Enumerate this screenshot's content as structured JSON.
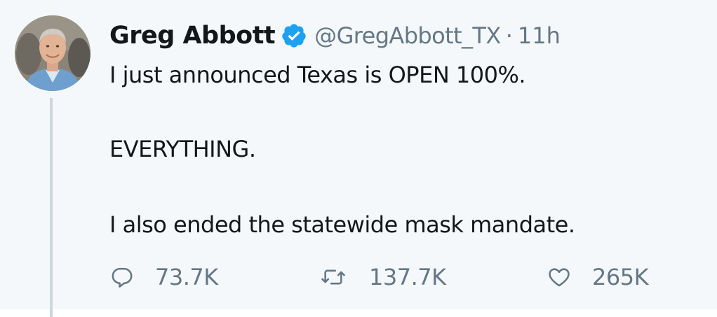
{
  "tweet": {
    "author": {
      "display_name": "Greg Abbott",
      "handle": "@GregAbbott_TX",
      "verified": true,
      "verified_icon": "verified-badge-icon"
    },
    "separator": "·",
    "timestamp": "11h",
    "body_lines": [
      "I just announced Texas is OPEN 100%.",
      "EVERYTHING.",
      "I also ended the statewide mask mandate."
    ],
    "actions": {
      "reply": {
        "icon": "reply-icon",
        "count": "73.7K"
      },
      "retweet": {
        "icon": "retweet-icon",
        "count": "137.7K"
      },
      "like": {
        "icon": "heart-icon",
        "count": "265K"
      }
    }
  },
  "colors": {
    "background": "#f5f8fa",
    "text_primary": "#14171a",
    "text_secondary": "#657786",
    "verified_blue": "#1da1f2",
    "thread_line": "#ccd6dd"
  }
}
